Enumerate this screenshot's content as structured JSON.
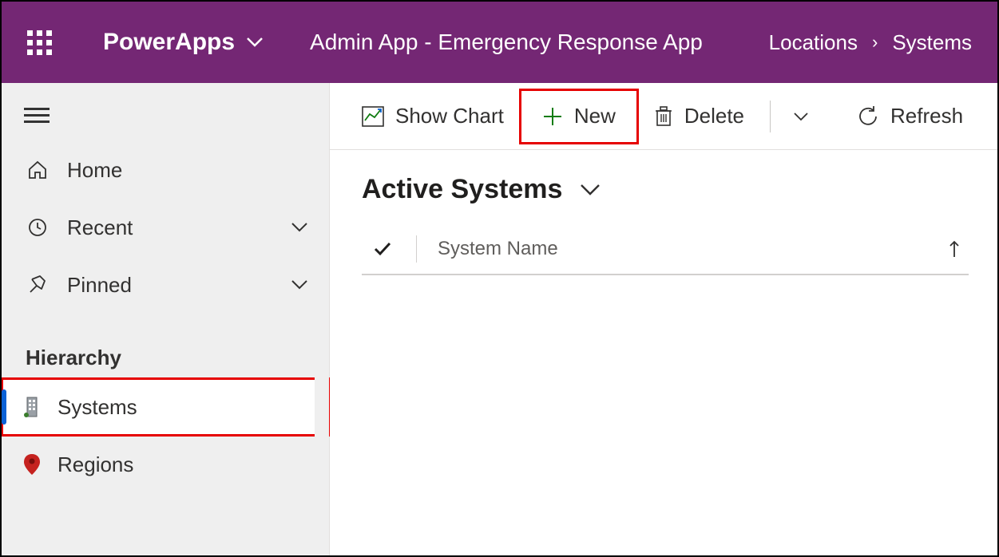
{
  "header": {
    "brand": "PowerApps",
    "app_title": "Admin App - Emergency Response App",
    "breadcrumbs": {
      "parent": "Locations",
      "current": "Systems"
    }
  },
  "sidebar": {
    "items": [
      {
        "label": "Home"
      },
      {
        "label": "Recent"
      },
      {
        "label": "Pinned"
      }
    ],
    "section_label": "Hierarchy",
    "sub": [
      {
        "label": "Systems"
      },
      {
        "label": "Regions"
      }
    ]
  },
  "commands": {
    "show_chart": "Show Chart",
    "new": "New",
    "delete": "Delete",
    "refresh": "Refresh"
  },
  "view": {
    "title": "Active Systems",
    "columns": {
      "col1": "System Name"
    }
  }
}
